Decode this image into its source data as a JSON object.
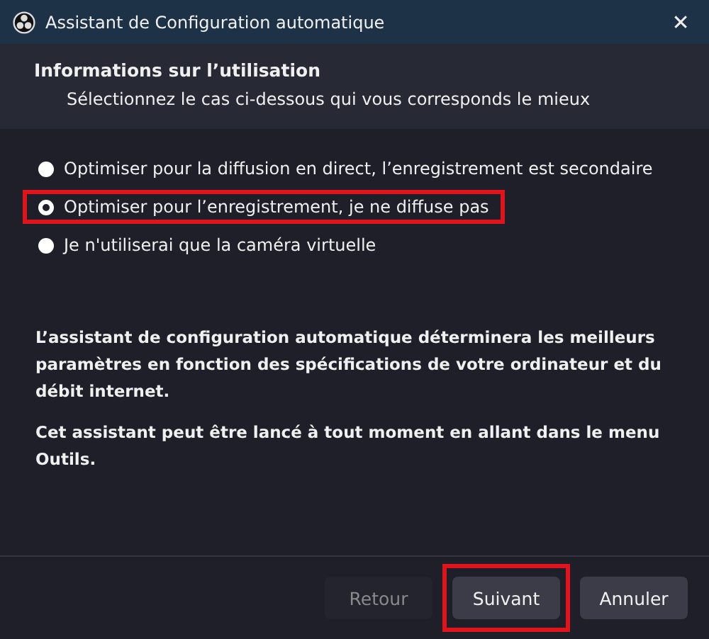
{
  "window": {
    "title": "Assistant de Configuration automatique",
    "close": "✕"
  },
  "header": {
    "title": "Informations sur l’utilisation",
    "subtitle": "Sélectionnez le cas ci-dessous qui vous corresponds le mieux"
  },
  "options": [
    {
      "label": "Optimiser pour la diffusion en direct, l’enregistrement est secondaire",
      "selected": false,
      "highlighted": false
    },
    {
      "label": "Optimiser pour l’enregistrement, je ne diffuse pas",
      "selected": true,
      "highlighted": true
    },
    {
      "label": "Je n'utiliserai que la caméra virtuelle",
      "selected": false,
      "highlighted": false
    }
  ],
  "paragraphs": [
    "L’assistant de configuration automatique déterminera les meilleurs paramètres en fonction des spécifications de votre ordinateur et du débit internet.",
    "Cet assistant peut être lancé à tout moment en allant dans le menu Outils."
  ],
  "buttons": [
    {
      "label": "Retour",
      "disabled": true,
      "highlighted": false
    },
    {
      "label": "Suivant",
      "disabled": false,
      "highlighted": true
    },
    {
      "label": "Annuler",
      "disabled": false,
      "highlighted": false
    }
  ]
}
